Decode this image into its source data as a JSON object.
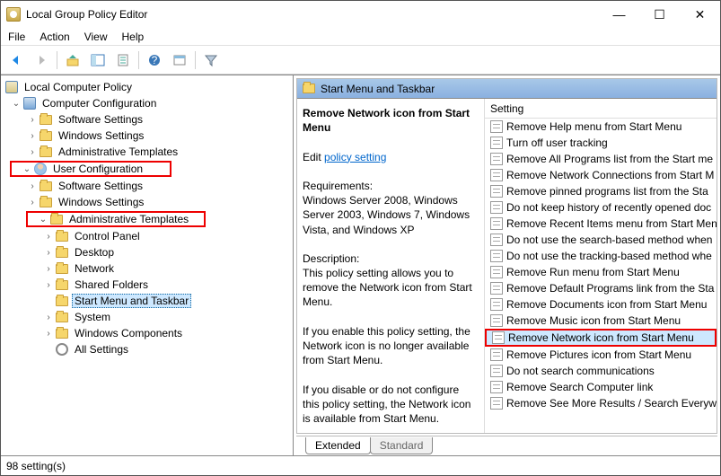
{
  "window": {
    "title": "Local Group Policy Editor"
  },
  "menu": {
    "file": "File",
    "action": "Action",
    "view": "View",
    "help": "Help"
  },
  "tree": {
    "root": "Local Computer Policy",
    "computer": "Computer Configuration",
    "comp_children": [
      "Software Settings",
      "Windows Settings",
      "Administrative Templates"
    ],
    "user": "User Configuration",
    "user_children": [
      "Software Settings",
      "Windows Settings"
    ],
    "admin": "Administrative Templates",
    "admin_children": [
      "Control Panel",
      "Desktop",
      "Network",
      "Shared Folders",
      "Start Menu and Taskbar",
      "System",
      "Windows Components",
      "All Settings"
    ]
  },
  "detail": {
    "header": "Start Menu and Taskbar",
    "title": "Remove Network icon from Start Menu",
    "edit": "Edit",
    "editLink": "policy setting",
    "reqLabel": "Requirements:",
    "reqText": "Windows Server 2008, Windows Server 2003, Windows 7, Windows Vista, and Windows XP",
    "descLabel": "Description:",
    "desc1": "This policy setting allows you to remove the Network icon from Start Menu.",
    "desc2": "If you enable this policy setting, the Network icon is no longer available from Start Menu.",
    "desc3": "If you disable or do not configure this policy setting, the Network icon is available from Start Menu.",
    "colSetting": "Setting",
    "settings": [
      "Remove Help menu from Start Menu",
      "Turn off user tracking",
      "Remove All Programs list from the Start me",
      "Remove Network Connections from Start M",
      "Remove pinned programs list from the Sta",
      "Do not keep history of recently opened doc",
      "Remove Recent Items menu from Start Men",
      "Do not use the search-based method when",
      "Do not use the tracking-based method whe",
      "Remove Run menu from Start Menu",
      "Remove Default Programs link from the Sta",
      "Remove Documents icon from Start Menu",
      "Remove Music icon from Start Menu",
      "Remove Network icon from Start Menu",
      "Remove Pictures icon from Start Menu",
      "Do not search communications",
      "Remove Search Computer link",
      "Remove See More Results / Search Everywh"
    ],
    "highlighted": 13
  },
  "tabs": {
    "extended": "Extended",
    "standard": "Standard"
  },
  "status": "98 setting(s)"
}
